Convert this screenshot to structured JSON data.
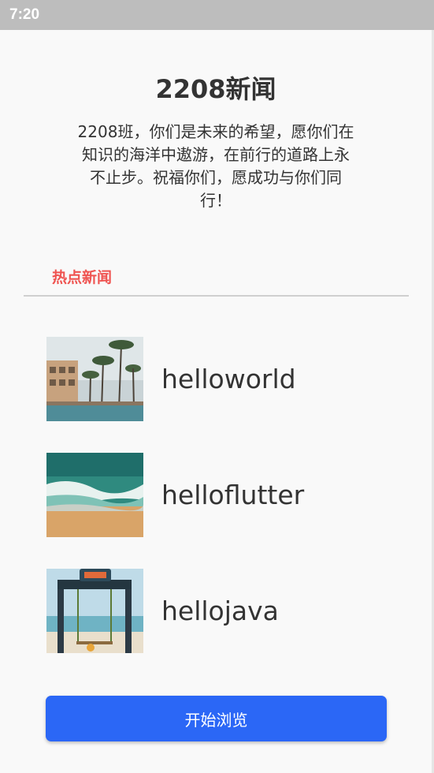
{
  "status_bar": {
    "time": "7:20"
  },
  "header": {
    "title": "2208新闻",
    "intro": "2208班，你们是未来的希望，愿你们在知识的海洋中遨游，在前行的道路上永不止步。祝福你们，愿成功与你们同行！"
  },
  "hot_news": {
    "heading": "热点新闻",
    "heading_color": "#ef5350",
    "items": [
      {
        "title": "helloworld",
        "image": "resort-palm-pool"
      },
      {
        "title": "helloflutter",
        "image": "aerial-beach-waves"
      },
      {
        "title": "hellojava",
        "image": "beach-swing-gate"
      }
    ]
  },
  "actions": {
    "start_label": "开始浏览",
    "button_color": "#2b67f6"
  }
}
